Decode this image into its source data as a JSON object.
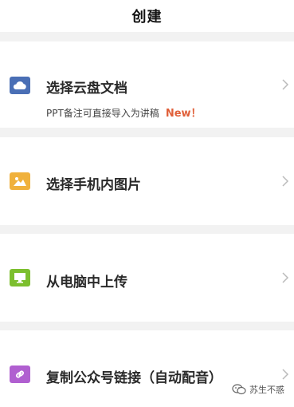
{
  "header": {
    "title": "创建"
  },
  "options": [
    {
      "label": "选择云盘文档",
      "sub": "PPT备注可直接导入为讲稿",
      "badge": "New！",
      "icon": "cloud-icon",
      "color": "#4a6fb5"
    },
    {
      "label": "选择手机内图片",
      "icon": "image-icon",
      "color": "#f0b13c"
    },
    {
      "label": "从电脑中上传",
      "icon": "monitor-icon",
      "color": "#7cbf2e"
    },
    {
      "label": "复制公众号链接（自动配音）",
      "icon": "link-icon",
      "color": "#b05fd0"
    }
  ],
  "colors": {
    "badge": "#e0603a",
    "chevron": "#bbbbbb",
    "background": "#f2f2f2"
  },
  "watermark": {
    "text": "苏生不惑",
    "icon": "wechat-icon"
  }
}
